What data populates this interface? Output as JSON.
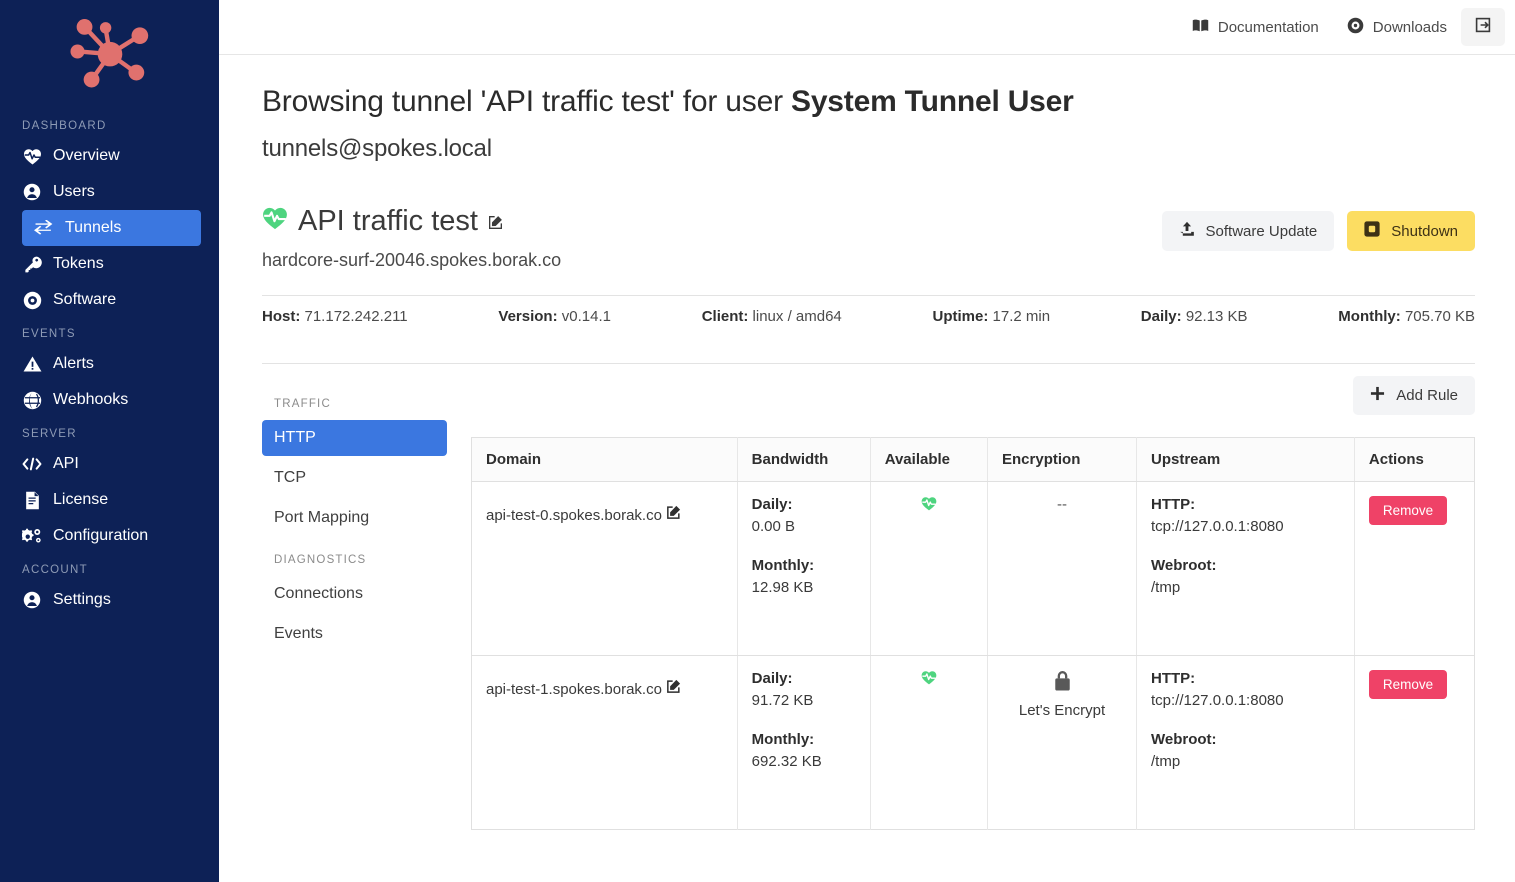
{
  "sidebar": {
    "logo_name": "network-hub-logo",
    "sections": [
      {
        "label": "DASHBOARD",
        "items": [
          {
            "label": "Overview",
            "icon": "heartbeat-icon",
            "active": false
          },
          {
            "label": "Users",
            "icon": "user-icon",
            "active": false
          },
          {
            "label": "Tunnels",
            "icon": "exchange-icon",
            "active": true
          },
          {
            "label": "Tokens",
            "icon": "key-icon",
            "active": false
          },
          {
            "label": "Software",
            "icon": "disc-icon",
            "active": false
          }
        ]
      },
      {
        "label": "EVENTS",
        "items": [
          {
            "label": "Alerts",
            "icon": "warning-icon",
            "active": false
          },
          {
            "label": "Webhooks",
            "icon": "globe-icon",
            "active": false
          }
        ]
      },
      {
        "label": "SERVER",
        "items": [
          {
            "label": "API",
            "icon": "code-icon",
            "active": false
          },
          {
            "label": "License",
            "icon": "document-icon",
            "active": false
          },
          {
            "label": "Configuration",
            "icon": "gears-icon",
            "active": false
          }
        ]
      },
      {
        "label": "ACCOUNT",
        "items": [
          {
            "label": "Settings",
            "icon": "user-circle-icon",
            "active": false
          }
        ]
      }
    ]
  },
  "topbar": {
    "documentation": "Documentation",
    "downloads": "Downloads"
  },
  "header": {
    "title_prefix": "Browsing tunnel 'API traffic test' for user ",
    "title_user": "System Tunnel User",
    "subtitle": "tunnels@spokes.local"
  },
  "tunnel": {
    "name": "API traffic test",
    "host": "hardcore-surf-20046.spokes.borak.co",
    "software_update_label": "Software Update",
    "shutdown_label": "Shutdown",
    "stats": [
      {
        "label": "Host:",
        "value": "71.172.242.211"
      },
      {
        "label": "Version:",
        "value": "v0.14.1"
      },
      {
        "label": "Client:",
        "value": "linux / amd64"
      },
      {
        "label": "Uptime:",
        "value": "17.2 min"
      },
      {
        "label": "Daily:",
        "value": "92.13 KB"
      },
      {
        "label": "Monthly:",
        "value": "705.70 KB"
      }
    ]
  },
  "subnav": {
    "traffic_label": "TRAFFIC",
    "diagnostics_label": "DIAGNOSTICS",
    "traffic_items": [
      {
        "label": "HTTP",
        "active": true
      },
      {
        "label": "TCP",
        "active": false
      },
      {
        "label": "Port Mapping",
        "active": false
      }
    ],
    "diagnostics_items": [
      {
        "label": "Connections",
        "active": false
      },
      {
        "label": "Events",
        "active": false
      }
    ]
  },
  "rules": {
    "add_rule_label": "Add Rule",
    "columns": [
      "Domain",
      "Bandwidth",
      "Available",
      "Encryption",
      "Upstream",
      "Actions"
    ],
    "labels": {
      "daily": "Daily:",
      "monthly": "Monthly:",
      "http": "HTTP:",
      "webroot": "Webroot:",
      "remove": "Remove"
    },
    "rows": [
      {
        "domain": "api-test-0.spokes.borak.co",
        "daily": "0.00 B",
        "monthly": "12.98 KB",
        "available": "healthy",
        "encryption": "--",
        "encryption_has_lock": false,
        "upstream_http": "tcp://127.0.0.1:8080",
        "upstream_webroot": "/tmp",
        "action": "Remove"
      },
      {
        "domain": "api-test-1.spokes.borak.co",
        "daily": "91.72 KB",
        "monthly": "692.32 KB",
        "available": "healthy",
        "encryption": "Let's Encrypt",
        "encryption_has_lock": true,
        "upstream_http": "tcp://127.0.0.1:8080",
        "upstream_webroot": "/tmp",
        "action": "Remove"
      }
    ]
  },
  "colors": {
    "sidebar_bg": "#0d2156",
    "accent_blue": "#3b77e0",
    "logo_red": "#e0716e",
    "warn_yellow": "#fcdd62",
    "danger_pink": "#ef4267",
    "healthy_green": "#4ed47f"
  }
}
